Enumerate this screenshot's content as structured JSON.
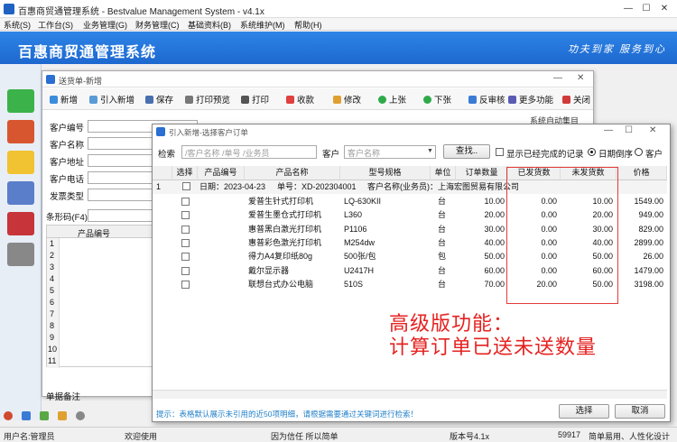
{
  "window": {
    "title": "百惠商贸通管理系统 - Bestvalue Management System - v4.1x",
    "minimize": "—",
    "maximize": "☐",
    "close": "✕"
  },
  "menu": [
    "系统(S)",
    "工作台(S)",
    "业务管理(G)",
    "财务管理(C)",
    "基础资料(B)",
    "系统维护(M)",
    "帮助(H)"
  ],
  "banner": {
    "title": "百惠商贸通管理系统",
    "slogan": "功夫到家 服务到心"
  },
  "delivery_window": {
    "title": "送货单-新增",
    "toolbar": [
      "新增",
      "引入新增",
      "保存",
      "打印预览",
      "打印",
      "收款",
      "修改",
      "上张",
      "下张",
      "反审核",
      "更多功能",
      "关闭"
    ],
    "fields": [
      "客户编号",
      "客户名称",
      "客户地址",
      "客户电话",
      "发票类型",
      "条形码(F4)"
    ],
    "grid_header": "产品编号",
    "row_numbers": [
      "1",
      "2",
      "3",
      "4",
      "5",
      "6",
      "7",
      "8",
      "9",
      "10",
      "11"
    ],
    "remark_label": "单据备注",
    "partial_text": "系统自动集目"
  },
  "import_window": {
    "title": "引入新增-选择客户订单",
    "search_label": "检索",
    "search_placeholder": "/客户名称 /单号 /业务员",
    "customer_label": "客户",
    "customer_placeholder": "客户名称",
    "find_button": "查找..",
    "show_completed": "显示已经完成的记录",
    "sort_date_desc": "日期倒序",
    "sort_customer": "客户",
    "columns": [
      "选择",
      "产品编号",
      "产品名称",
      "型号规格",
      "单位",
      "订单数量",
      "已发货数",
      "未发货数",
      "价格"
    ],
    "group_row": {
      "index": "1",
      "date": "日期：2023-04-23",
      "order_no": "单号：XD-202304001",
      "customer": "客户名称(业务员)：上海宏图贸易有限公司"
    },
    "rows": [
      {
        "name": "爱普生针式打印机",
        "model": "LQ-630KII",
        "unit": "台",
        "qty": "10.00",
        "shipped": "0.00",
        "unshipped": "10.00",
        "price": "1549.00"
      },
      {
        "name": "爱普生墨仓式打印机",
        "model": "L360",
        "unit": "台",
        "qty": "20.00",
        "shipped": "0.00",
        "unshipped": "20.00",
        "price": "949.00"
      },
      {
        "name": "惠普黑白激光打印机",
        "model": "P1106",
        "unit": "台",
        "qty": "30.00",
        "shipped": "0.00",
        "unshipped": "30.00",
        "price": "829.00"
      },
      {
        "name": "惠普彩色激光打印机",
        "model": "M254dw",
        "unit": "台",
        "qty": "40.00",
        "shipped": "0.00",
        "unshipped": "40.00",
        "price": "2899.00"
      },
      {
        "name": "得力A4复印纸80g",
        "model": "500张/包",
        "unit": "包",
        "qty": "50.00",
        "shipped": "0.00",
        "unshipped": "50.00",
        "price": "26.00"
      },
      {
        "name": "戴尔显示器",
        "model": "U2417H",
        "unit": "台",
        "qty": "60.00",
        "shipped": "0.00",
        "unshipped": "60.00",
        "price": "1479.00"
      },
      {
        "name": "联想台式办公电脑",
        "model": "510S",
        "unit": "台",
        "qty": "70.00",
        "shipped": "20.00",
        "unshipped": "50.00",
        "price": "3198.00"
      }
    ],
    "annotation_line1": "高级版功能：",
    "annotation_line2": "计算订单已送未送数量",
    "hint": "提示：表格默认展示未引用的近50项明细，请根据需要通过关键词进行检索！",
    "select_button": "选择",
    "cancel_button": "取消"
  },
  "status_bar": {
    "user": "用户名:管理员",
    "welcome": "欢迎使用",
    "motto": "因为信任 所以简单",
    "version": "版本号4.1x",
    "count": "59917",
    "tagline": "简单易用、人性化设计"
  },
  "colors": {
    "banner": "#1d68cf",
    "accent": "#2e84e6",
    "annotation": "#e52220",
    "highlight_box": "#e53a3a"
  }
}
